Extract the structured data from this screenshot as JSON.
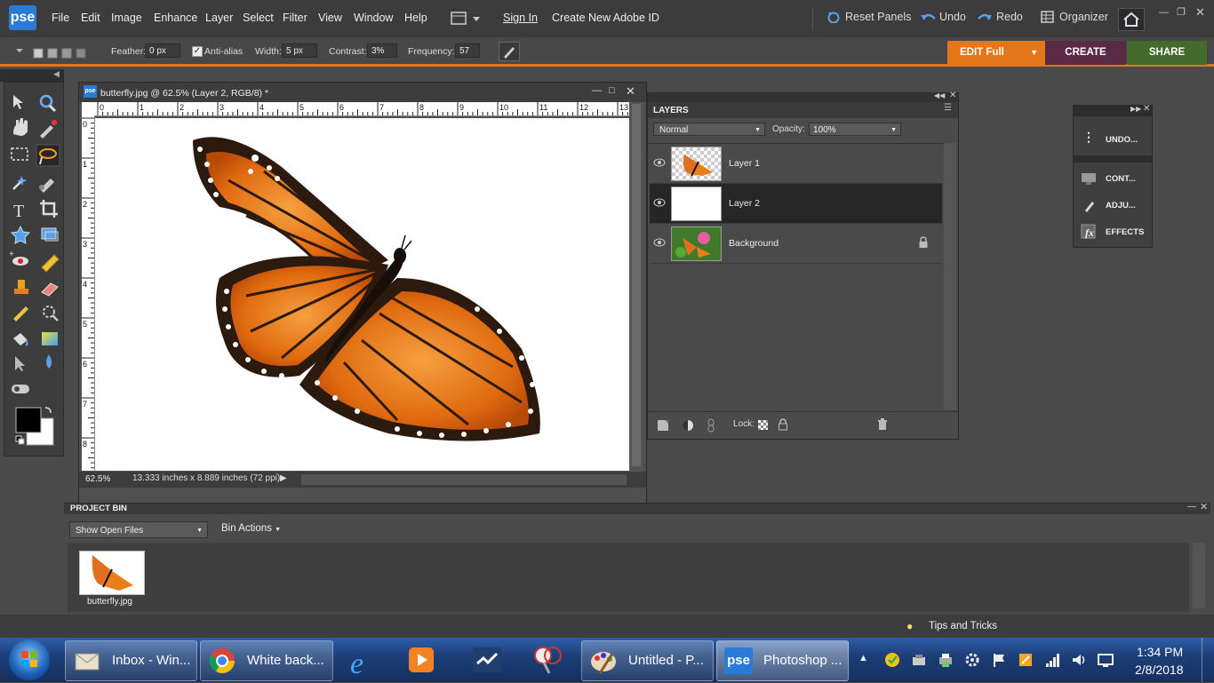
{
  "app": {
    "logo": "pse",
    "menus": [
      "File",
      "Edit",
      "Image",
      "Enhance",
      "Layer",
      "Select",
      "Filter",
      "View",
      "Window",
      "Help"
    ],
    "sign_in": "Sign In",
    "create_id": "Create New Adobe ID",
    "reset_panels": "Reset Panels",
    "undo": "Undo",
    "redo": "Redo",
    "organizer": "Organizer"
  },
  "options": {
    "feather_label": "Feather:",
    "feather_value": "0 px",
    "antialias_label": "Anti-alias",
    "width_label": "Width:",
    "width_value": "5 px",
    "contrast_label": "Contrast:",
    "contrast_value": "3%",
    "frequency_label": "Frequency:",
    "frequency_value": "57"
  },
  "modes": {
    "edit": "EDIT Full",
    "create": "CREATE",
    "share": "SHARE"
  },
  "document": {
    "title": "butterfly.jpg @ 62.5% (Layer 2, RGB/8) *",
    "zoom": "62.5%",
    "doc_size": "13.333 inches x 8.889 inches (72 ppi)",
    "h_ruler": [
      "0",
      "1",
      "2",
      "3",
      "4",
      "5",
      "6",
      "7",
      "8",
      "9",
      "10",
      "11",
      "12",
      "13"
    ],
    "v_ruler": [
      "0",
      "1",
      "2",
      "3",
      "4",
      "5",
      "6",
      "7",
      "8"
    ]
  },
  "layers_panel": {
    "title": "LAYERS",
    "blend_mode": "Normal",
    "opacity_label": "Opacity:",
    "opacity_value": "100%",
    "lock_label": "Lock:",
    "layers": [
      {
        "name": "Layer 1",
        "selected": false,
        "locked": false
      },
      {
        "name": "Layer 2",
        "selected": true,
        "locked": false
      },
      {
        "name": "Background",
        "selected": false,
        "locked": true
      }
    ]
  },
  "mini_panel": {
    "undo": "UNDO...",
    "content": "CONT...",
    "adjust": "ADJU...",
    "effects": "EFFECTS"
  },
  "project_bin": {
    "title": "PROJECT BIN",
    "show_select": "Show Open Files",
    "bin_actions": "Bin Actions",
    "files": [
      "butterfly.jpg"
    ]
  },
  "tips": "Tips and Tricks",
  "taskbar": {
    "tasks": [
      "Inbox - Win...",
      "White back...",
      "Untitled - P...",
      "Photoshop ..."
    ],
    "time": "1:34 PM",
    "date": "2/8/2018"
  },
  "colors": {
    "accent_orange": "#e47719",
    "create_purple": "#5a2a45",
    "share_green": "#456b2c",
    "taskbar_blue": "#1d3f78"
  }
}
